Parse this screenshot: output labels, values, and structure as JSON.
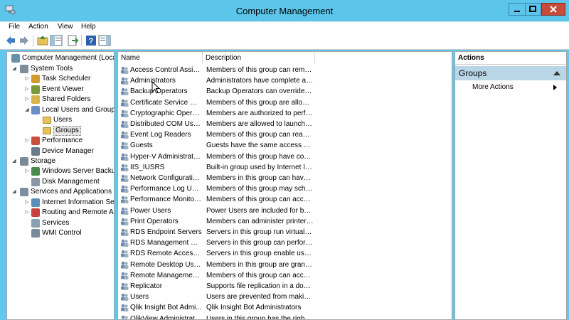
{
  "window": {
    "title": "Computer Management"
  },
  "menu": {
    "items": [
      "File",
      "Action",
      "View",
      "Help"
    ]
  },
  "toolbar": {
    "buttons": [
      "back-icon",
      "forward-icon",
      "up-folder-icon",
      "show-hide-console-tree-icon",
      "export-list-icon",
      "help-icon",
      "show-hide-action-pane-icon"
    ]
  },
  "tree": {
    "items": [
      {
        "label": "Computer Management (Local",
        "icon": "computer-management-icon"
      },
      {
        "label": "System Tools",
        "icon": "system-tools-icon"
      },
      {
        "label": "Task Scheduler",
        "icon": "task-scheduler-icon"
      },
      {
        "label": "Event Viewer",
        "icon": "event-viewer-icon"
      },
      {
        "label": "Shared Folders",
        "icon": "shared-folders-icon"
      },
      {
        "label": "Local Users and Groups",
        "icon": "local-users-groups-icon"
      },
      {
        "label": "Users",
        "icon": "folder-icon"
      },
      {
        "label": "Groups",
        "icon": "folder-icon"
      },
      {
        "label": "Performance",
        "icon": "performance-icon"
      },
      {
        "label": "Device Manager",
        "icon": "device-manager-icon"
      },
      {
        "label": "Storage",
        "icon": "storage-icon"
      },
      {
        "label": "Windows Server Backup",
        "icon": "backup-icon"
      },
      {
        "label": "Disk Management",
        "icon": "disk-management-icon"
      },
      {
        "label": "Services and Applications",
        "icon": "services-applications-icon"
      },
      {
        "label": "Internet Information Ser",
        "icon": "iis-icon"
      },
      {
        "label": "Routing and Remote Ac",
        "icon": "routing-icon"
      },
      {
        "label": "Services",
        "icon": "services-icon"
      },
      {
        "label": "WMI Control",
        "icon": "wmi-icon"
      }
    ]
  },
  "list": {
    "columns": [
      "Name",
      "Description"
    ],
    "rows": [
      {
        "name": "Access Control Assist...",
        "description": "Members of this group can remot..."
      },
      {
        "name": "Administrators",
        "description": "Administrators have complete an..."
      },
      {
        "name": "Backup Operators",
        "description": "Backup Operators can override se..."
      },
      {
        "name": "Certificate Service DC...",
        "description": "Members of this group are allowe..."
      },
      {
        "name": "Cryptographic Operat...",
        "description": "Members are authorized to perfor..."
      },
      {
        "name": "Distributed COM Users",
        "description": "Members are allowed to launch, a..."
      },
      {
        "name": "Event Log Readers",
        "description": "Members of this group can read e..."
      },
      {
        "name": "Guests",
        "description": "Guests have the same access as m..."
      },
      {
        "name": "Hyper-V Administrators",
        "description": "Members of this group have com..."
      },
      {
        "name": "IIS_IUSRS",
        "description": "Built-in group used by Internet Inf..."
      },
      {
        "name": "Network Configuratio...",
        "description": "Members in this group can have s..."
      },
      {
        "name": "Performance Log Users",
        "description": "Members of this group may sche..."
      },
      {
        "name": "Performance Monitor ...",
        "description": "Members of this group can acces..."
      },
      {
        "name": "Power Users",
        "description": "Power Users are included for back..."
      },
      {
        "name": "Print Operators",
        "description": "Members can administer printers ..."
      },
      {
        "name": "RDS Endpoint Servers",
        "description": "Servers in this group run virtual m..."
      },
      {
        "name": "RDS Management Ser...",
        "description": "Servers in this group can perform ..."
      },
      {
        "name": "RDS Remote Access S...",
        "description": "Servers in this group enable users ..."
      },
      {
        "name": "Remote Desktop Users",
        "description": "Members in this group are grante..."
      },
      {
        "name": "Remote Management...",
        "description": "Members of this group can acces..."
      },
      {
        "name": "Replicator",
        "description": "Supports file replication in a dom..."
      },
      {
        "name": "Users",
        "description": "Users are prevented from making ..."
      },
      {
        "name": "Qlik Insight Bot Admi...",
        "description": "Qlik Insight Bot Administrators"
      },
      {
        "name": "QlikView Administrat...",
        "description": "Users in this group has the right t..."
      }
    ]
  },
  "actions": {
    "header": "Actions",
    "group_title": "Groups",
    "more_actions": "More Actions"
  },
  "colors": {
    "titlebar": "#5cc5ea",
    "close_button": "#c74a3a",
    "actions_group_bg": "#b9d6e6"
  }
}
